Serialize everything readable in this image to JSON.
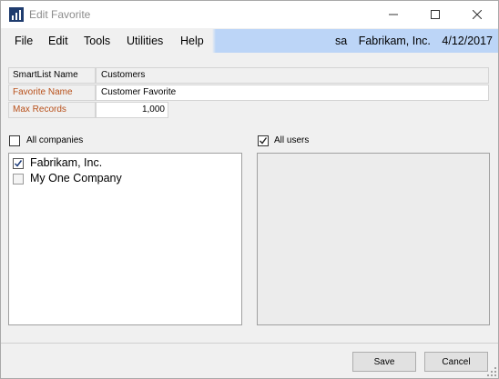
{
  "window": {
    "title": "Edit Favorite",
    "controls": {
      "minimize": "minimize",
      "maximize": "maximize",
      "close": "close"
    }
  },
  "menu": {
    "items": [
      "File",
      "Edit",
      "Tools",
      "Utilities",
      "Help"
    ]
  },
  "status": {
    "user": "sa",
    "company": "Fabrikam, Inc.",
    "date": "4/12/2017"
  },
  "form": {
    "smartlist_label": "SmartList Name",
    "smartlist_value": "Customers",
    "favorite_label": "Favorite Name",
    "favorite_value": "Customer Favorite",
    "max_records_label": "Max Records",
    "max_records_value": "1,000"
  },
  "companies": {
    "all_label": "All companies",
    "all_checked": false,
    "items": [
      {
        "label": "Fabrikam, Inc.",
        "checked": true
      },
      {
        "label": "My One Company",
        "checked": false
      }
    ]
  },
  "users": {
    "all_label": "All users",
    "all_checked": true,
    "items": []
  },
  "buttons": {
    "save": "Save",
    "cancel": "Cancel"
  },
  "colors": {
    "menu_highlight": "#bcd5f7",
    "required_label": "#b8501a",
    "background": "#f0f0f0"
  }
}
